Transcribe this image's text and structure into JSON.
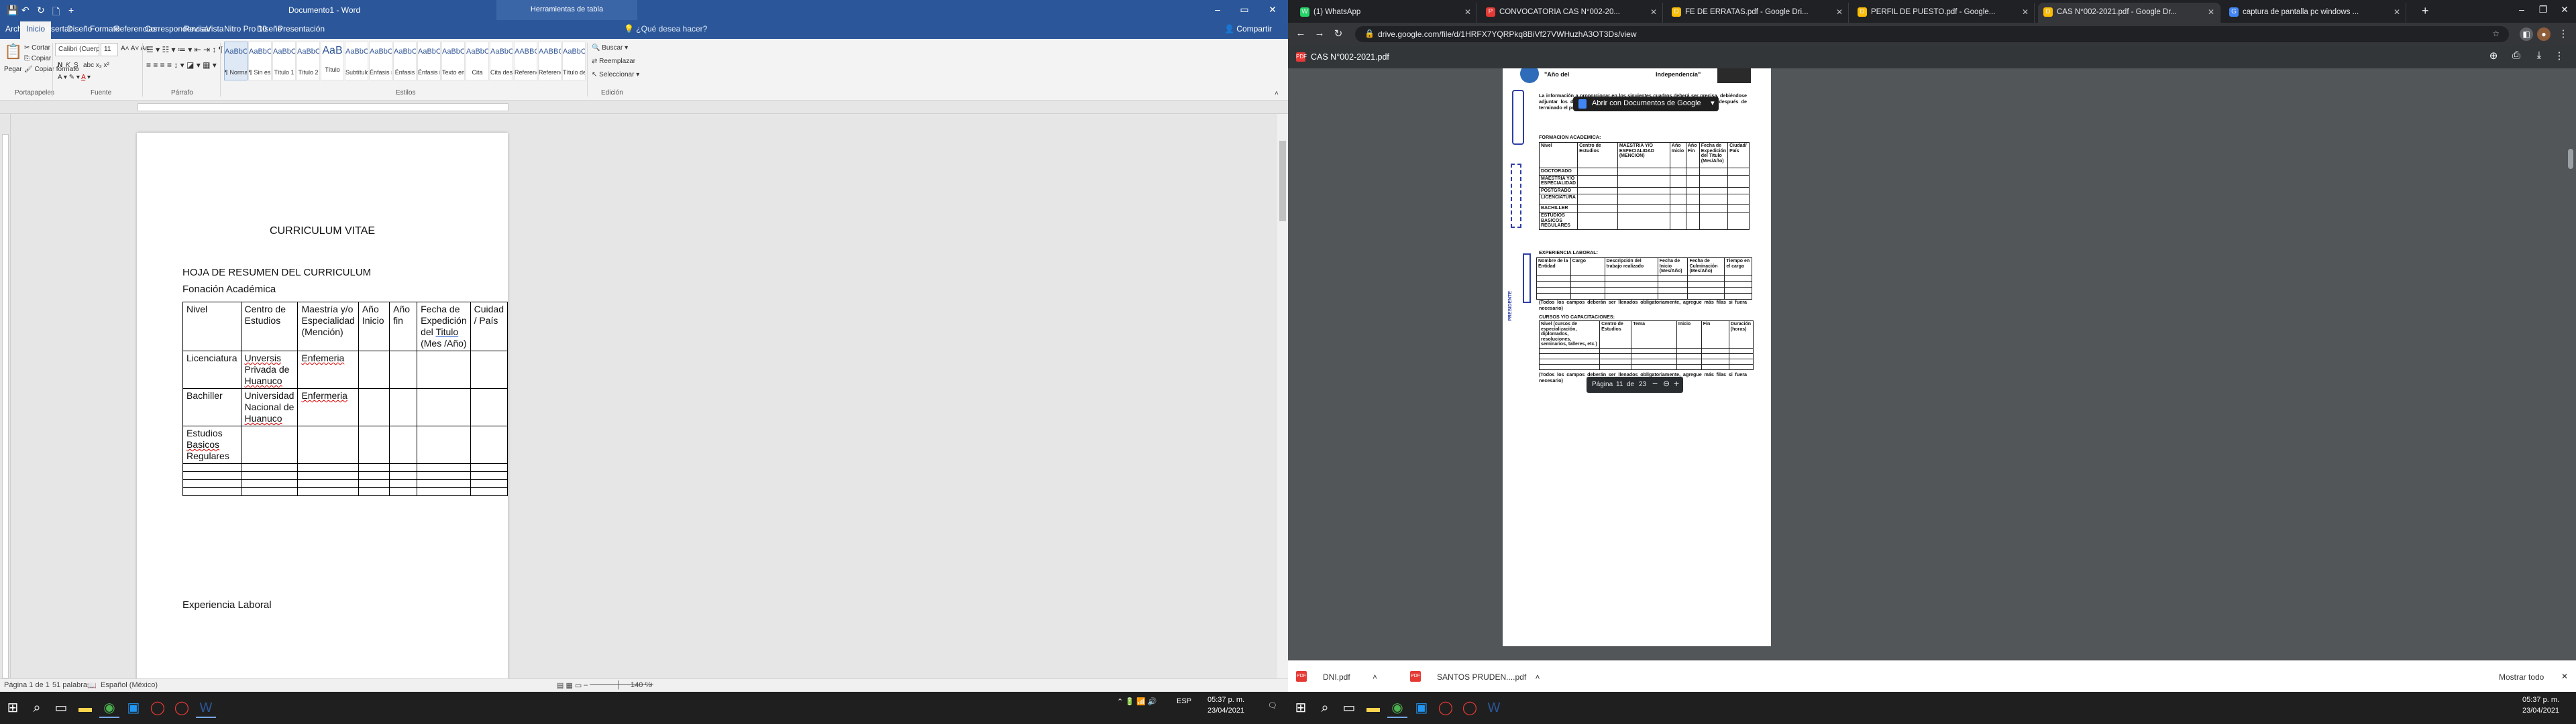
{
  "word": {
    "title_caption": "Documento1 - Word",
    "context_tab": "Herramientas de tabla",
    "tabs": [
      "Archivo",
      "Inicio",
      "Insertar",
      "Diseño",
      "Formato",
      "Referencias",
      "Correspondencia",
      "Revisar",
      "Vista",
      "Nitro Pro 10",
      "Diseño",
      "Presentación"
    ],
    "tell_me": "¿Qué desea hacer?",
    "share": "Compartir",
    "clipboard": {
      "paste": "Pegar",
      "cut": "Cortar",
      "copy": "Copiar",
      "format_painter": "Copiar formato",
      "label": "Portapapeles"
    },
    "font": {
      "name": "Calibri (Cuerpo",
      "size": "11",
      "label": "Fuente",
      "bold": "N",
      "italic": "K",
      "underline": "S"
    },
    "paragraph_label": "Párrafo",
    "styles_label": "Estilos",
    "styles": [
      {
        "pv": "AaBbCcDc",
        "nm": "¶ Normal"
      },
      {
        "pv": "AaBbCcDc",
        "nm": "¶ Sin espa..."
      },
      {
        "pv": "AaBbCc",
        "nm": "Título 1"
      },
      {
        "pv": "AaBbCcC",
        "nm": "Título 2"
      },
      {
        "pv": "AaB",
        "nm": "Título"
      },
      {
        "pv": "AaBbCcC",
        "nm": "Subtítulo"
      },
      {
        "pv": "AaBbCcDc",
        "nm": "Énfasis sutil"
      },
      {
        "pv": "AaBbCcDc",
        "nm": "Énfasis"
      },
      {
        "pv": "AaBbCcDc",
        "nm": "Énfasis int..."
      },
      {
        "pv": "AaBbCcDc",
        "nm": "Texto en n..."
      },
      {
        "pv": "AaBbCcDc",
        "nm": "Cita"
      },
      {
        "pv": "AaBbCcDc",
        "nm": "Cita desta..."
      },
      {
        "pv": "AABBCCDE",
        "nm": "Referencia..."
      },
      {
        "pv": "AABBCCDE",
        "nm": "Referencia..."
      },
      {
        "pv": "AaBbCcDc",
        "nm": "Título del l..."
      }
    ],
    "editing": {
      "find": "Buscar",
      "replace": "Reemplazar",
      "select": "Seleccionar",
      "label": "Edición"
    },
    "doc": {
      "title": "CURRICULUM VITAE",
      "summary": "HOJA DE RESUMEN DEL CURRICULUM",
      "section": "Fonación Académica",
      "headers": [
        "Nivel",
        "Centro de Estudios",
        "Maestría y/o Especialidad (Mención)",
        "Año Inicio",
        "Año fin",
        "Fecha de Expedición del",
        "Cuidad / País"
      ],
      "header_titulo": "Titulo",
      "header_mes": "(Mes /Año)",
      "row1": {
        "nivel": "Licenciatura",
        "centro_a": "Unversis",
        "centro_b": "Privada de",
        "centro_c": "Huanuco",
        "esp": "Enfemeria"
      },
      "row2": {
        "nivel": "Bachiller",
        "centro_a": "Universidad",
        "centro_b": "Nacional de",
        "centro_c": "Huanuco",
        "esp": "Enfermeria"
      },
      "row3": {
        "nivel_a": "Estudios",
        "nivel_b": "Basicos",
        "nivel_c": "Regulares"
      },
      "next_section": "Experiencia Laboral"
    },
    "status": {
      "page": "Página 1 de 1",
      "words": "51 palabras",
      "lang": "Español (México)",
      "zoom": "140 %"
    }
  },
  "taskbar_left": {
    "time": "05:37 p. m.",
    "date": "23/04/2021",
    "lang": "ESP"
  },
  "chrome": {
    "tabs": [
      {
        "title": "(1) WhatsApp",
        "color": "#25d366",
        "glyph": "W"
      },
      {
        "title": "CONVOCATORIA CAS N°002-20...",
        "color": "#e53935",
        "glyph": "P"
      },
      {
        "title": "FE DE ERRATAS.pdf - Google Dri...",
        "color": "#fbbc04",
        "glyph": "D"
      },
      {
        "title": "PERFIL DE PUESTO.pdf - Google...",
        "color": "#fbbc04",
        "glyph": "D"
      },
      {
        "title": "CAS N°002-2021.pdf - Google Dr...",
        "color": "#fbbc04",
        "glyph": "D"
      },
      {
        "title": "captura de pantalla pc windows ...",
        "color": "#4285f4",
        "glyph": "G"
      }
    ],
    "url": "drive.google.com/file/d/1HRFX7YQRPkq8BiVf27VWHuzhA3OT3Ds/view",
    "pdf_title": "CAS N°002-2021.pdf",
    "open_with": "Abrir con Documentos de Google",
    "page_ctrl": {
      "label": "Página",
      "current": "11",
      "of": "de",
      "total": "23"
    },
    "downloads": [
      {
        "name": "DNI.pdf"
      },
      {
        "name": "SANTOS PRUDEN....pdf"
      }
    ],
    "show_all": "Mostrar todo"
  },
  "pdf": {
    "header_year": "\"Año del",
    "header_tail": "Independencia\"",
    "intro": "La información a proporcionar en los siguientes cuadros deberá ser precisa, debiéndose adjuntar los documentos que sustente lo informado (orden cronológico) después de terminado el proceso CAS.",
    "formacion": "FORMACION ACADEMICA:",
    "form_headers": [
      "Nivel",
      "Centro de Estudios",
      "MAESTRIA Y/O ESPECIALIDAD (MENCION)",
      "Año Inicio",
      "Año Fin",
      "Fecha de Expedición del Titulo (Mes/Año)",
      "Ciudad/ País"
    ],
    "form_rows": [
      "DOCTORADO",
      "MAESTRIA Y/O ESPECIALIDAD",
      "POSTGRADO",
      "LICENCIATURA",
      "BACHILLER",
      "ESTUDIOS BASICOS REGULARES"
    ],
    "experiencia": "EXPERIENCIA LABORAL:",
    "exp_headers": [
      "Nombre de la Entidad",
      "Cargo",
      "Descripción del trabajo realizado",
      "Fecha de Inicio (Mes/Año)",
      "Fecha de Culminación (Mes/Año)",
      "Tiempo en el cargo"
    ],
    "note": "(Todos los campos deberán ser llenados obligatoriamente, agregue más filas si fuera necesario)",
    "cursos": "CURSOS Y/O CAPACITACIONES:",
    "cur_headers": [
      "Nivel (cursos de especialización, diplomados, resoluciones, seminarios, talleres, etc.)",
      "Centro de Estudios",
      "Tema",
      "Inicio",
      "Fin",
      "Duración (horas)"
    ],
    "stamp_text": "PRESIDENTE"
  },
  "taskbar_right": {
    "time": "05:37 p. m.",
    "date": "23/04/2021"
  }
}
